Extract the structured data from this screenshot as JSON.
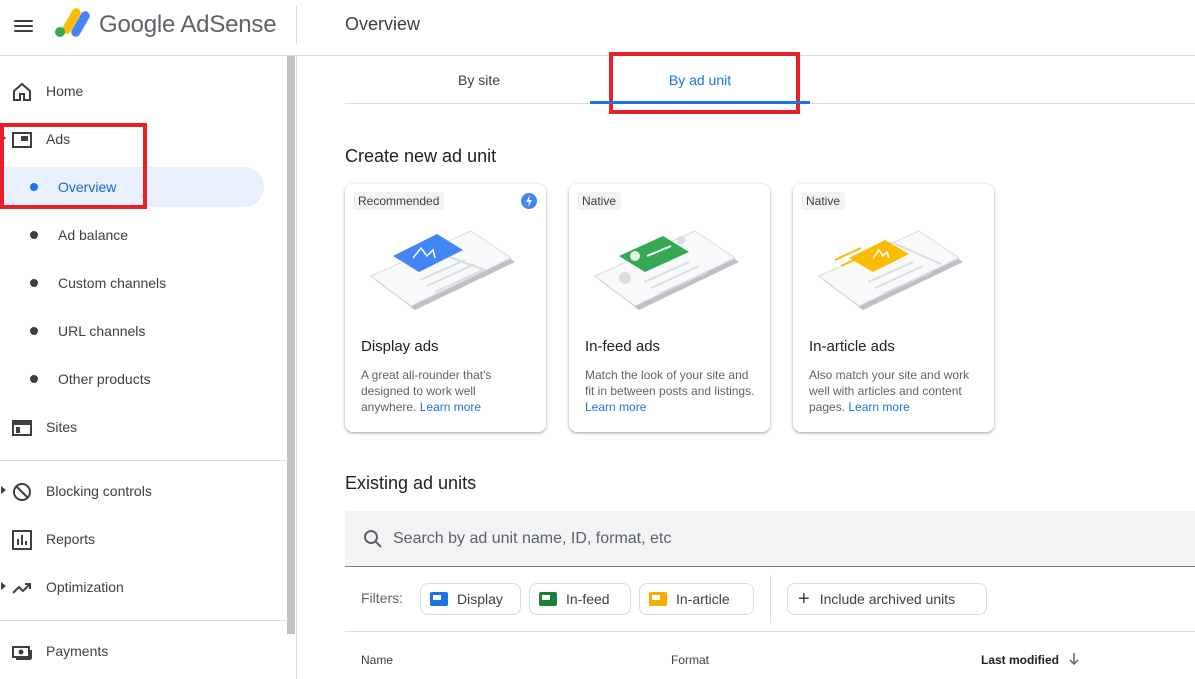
{
  "header": {
    "app_name_google": "Google",
    "app_name_product": "AdSense",
    "page_title": "Overview"
  },
  "sidebar": {
    "items": [
      {
        "label": "Home",
        "icon": "home-icon"
      },
      {
        "label": "Ads",
        "icon": "ads-icon"
      },
      {
        "label": "Overview"
      },
      {
        "label": "Ad balance"
      },
      {
        "label": "Custom channels"
      },
      {
        "label": "URL channels"
      },
      {
        "label": "Other products"
      },
      {
        "label": "Sites",
        "icon": "sites-icon"
      },
      {
        "label": "Blocking controls",
        "icon": "block-icon"
      },
      {
        "label": "Reports",
        "icon": "reports-icon"
      },
      {
        "label": "Optimization",
        "icon": "trending-icon"
      },
      {
        "label": "Payments",
        "icon": "payments-icon"
      }
    ]
  },
  "tabs": [
    {
      "label": "By site"
    },
    {
      "label": "By ad unit"
    }
  ],
  "create": {
    "title": "Create new ad unit",
    "cards": [
      {
        "chip": "Recommended",
        "title": "Display ads",
        "desc": "A great all-rounder that's designed to work well anywhere.",
        "link": "Learn more",
        "accent": "#4285f4"
      },
      {
        "chip": "Native",
        "title": "In-feed ads",
        "desc": "Match the look of your site and fit in between posts and listings.",
        "link": "Learn more",
        "accent": "#34a853"
      },
      {
        "chip": "Native",
        "title": "In-article ads",
        "desc": "Also match your site and work well with articles and content pages.",
        "link": "Learn more",
        "accent": "#fbbc04"
      }
    ]
  },
  "existing": {
    "title": "Existing ad units",
    "search_placeholder": "Search by ad unit name, ID, format, etc",
    "filters_label": "Filters:",
    "filters": [
      {
        "label": "Display",
        "color": "#1a73e8"
      },
      {
        "label": "In-feed",
        "color": "#188038"
      },
      {
        "label": "In-article",
        "color": "#f9ab00"
      }
    ],
    "archived_label": "Include archived units",
    "columns": [
      "Name",
      "Format",
      "Last modified"
    ]
  }
}
